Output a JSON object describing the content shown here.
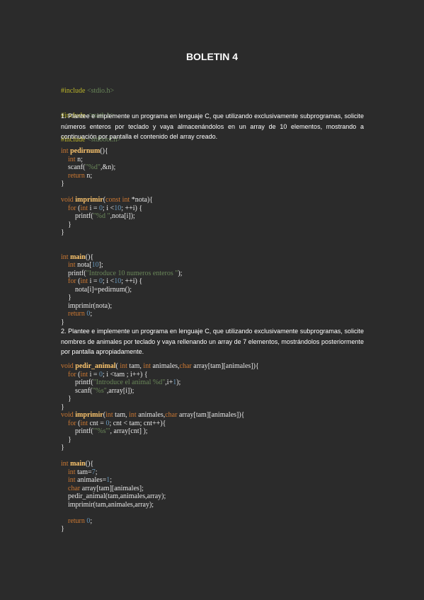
{
  "title": "BOLETIN 4",
  "includes": [
    {
      "directive": "#include",
      "header": "<stdio.h>"
    },
    {
      "directive": "#include",
      "header": "<math.h>"
    },
    {
      "directive": "#include",
      "header": "<stdbool.h>"
    }
  ],
  "exercise1": "1. Plantee e implemente un programa en lenguaje C, que utilizando exclusivamente subprogramas, solicite números enteros por teclado y vaya almacenándolos en un array de 10 elementos, mostrando a continuación por pantalla el contenido del array creado.",
  "exercise2": "2. Plantee e implemente un programa en lenguaje C, que utilizando exclusivamente subprogramas, solicite nombres de animales por teclado y vaya rellenando un array de 7 elementos, mostrándolos posteriormente por pantalla apropiadamente.",
  "code1": [
    [
      [
        "kw",
        "int "
      ],
      [
        "fn",
        "pedirnum"
      ],
      [
        "",
        "(){"
      ]
    ],
    [
      [
        "",
        "    "
      ],
      [
        "kw",
        "int "
      ],
      [
        "",
        "n;"
      ]
    ],
    [
      [
        "",
        "    scanf("
      ],
      [
        "str",
        "\"%d\""
      ],
      [
        "",
        ",&n);"
      ]
    ],
    [
      [
        "",
        "    "
      ],
      [
        "kw",
        "return "
      ],
      [
        "",
        "n;"
      ]
    ],
    [
      [
        "",
        "}"
      ]
    ],
    [
      [
        "",
        ""
      ]
    ],
    [
      [
        "kw",
        "void "
      ],
      [
        "fn",
        "imprimir"
      ],
      [
        "",
        "("
      ],
      [
        "kw",
        "const int "
      ],
      [
        "",
        "*nota){"
      ]
    ],
    [
      [
        "",
        "    "
      ],
      [
        "kw",
        "for "
      ],
      [
        "",
        "("
      ],
      [
        "kw",
        "int "
      ],
      [
        "",
        "i = "
      ],
      [
        "num",
        "0"
      ],
      [
        "",
        "; i <"
      ],
      [
        "num",
        "10"
      ],
      [
        "",
        "; ++i) {"
      ]
    ],
    [
      [
        "",
        "        printf("
      ],
      [
        "str",
        "\"%d \""
      ],
      [
        "",
        ",nota[i]);"
      ]
    ],
    [
      [
        "",
        "    }"
      ]
    ],
    [
      [
        "",
        "}"
      ]
    ],
    [
      [
        "",
        ""
      ]
    ],
    [
      [
        "",
        ""
      ]
    ],
    [
      [
        "kw",
        "int "
      ],
      [
        "fn",
        "main"
      ],
      [
        "",
        "(){"
      ]
    ],
    [
      [
        "",
        "    "
      ],
      [
        "kw",
        "int "
      ],
      [
        "",
        "nota["
      ],
      [
        "num",
        "10"
      ],
      [
        "",
        "];"
      ]
    ],
    [
      [
        "",
        "    printf("
      ],
      [
        "str",
        "\"Introduce 10 numeros enteros \""
      ],
      [
        "",
        ");"
      ]
    ],
    [
      [
        "",
        "    "
      ],
      [
        "kw",
        "for "
      ],
      [
        "",
        "("
      ],
      [
        "kw",
        "int "
      ],
      [
        "",
        "i = "
      ],
      [
        "num",
        "0"
      ],
      [
        "",
        "; i <"
      ],
      [
        "num",
        "10"
      ],
      [
        "",
        "; ++i) {"
      ]
    ],
    [
      [
        "",
        "        nota[i]=pedirnum();"
      ]
    ],
    [
      [
        "",
        "    }"
      ]
    ],
    [
      [
        "",
        "    imprimir(nota);"
      ]
    ],
    [
      [
        "",
        "    "
      ],
      [
        "kw",
        "return "
      ],
      [
        "num",
        "0"
      ],
      [
        "",
        ";"
      ]
    ],
    [
      [
        "",
        "}"
      ]
    ]
  ],
  "code2": [
    [
      [
        "kw",
        "void "
      ],
      [
        "fn",
        "pedir_animal"
      ],
      [
        "",
        "( "
      ],
      [
        "kw",
        "int "
      ],
      [
        "",
        "tam, "
      ],
      [
        "kw",
        "int "
      ],
      [
        "",
        "animales,"
      ],
      [
        "kw",
        "char "
      ],
      [
        "",
        "array[tam][animales]){"
      ]
    ],
    [
      [
        "",
        "    "
      ],
      [
        "kw",
        "for "
      ],
      [
        "",
        "("
      ],
      [
        "kw",
        "int "
      ],
      [
        "",
        "i = "
      ],
      [
        "num",
        "0"
      ],
      [
        "",
        "; i <tam ; i++) {"
      ]
    ],
    [
      [
        "",
        "        printf("
      ],
      [
        "str",
        "\"Introduce el animal %d\""
      ],
      [
        "",
        ",i+"
      ],
      [
        "num",
        "1"
      ],
      [
        "",
        ");"
      ]
    ],
    [
      [
        "",
        "        scanf("
      ],
      [
        "str",
        "\"%s\""
      ],
      [
        "",
        ",array[i]);"
      ]
    ],
    [
      [
        "",
        "    }"
      ]
    ],
    [
      [
        "",
        "}"
      ]
    ],
    [
      [
        "kw",
        "void "
      ],
      [
        "fn",
        "imprimir"
      ],
      [
        "",
        "("
      ],
      [
        "kw",
        "int "
      ],
      [
        "",
        "tam, "
      ],
      [
        "kw",
        "int "
      ],
      [
        "",
        "animales,"
      ],
      [
        "kw",
        "char "
      ],
      [
        "",
        "array[tam][animales]){"
      ]
    ],
    [
      [
        "",
        "    "
      ],
      [
        "kw",
        "for "
      ],
      [
        "",
        "("
      ],
      [
        "kw",
        "int "
      ],
      [
        "",
        "cnt = "
      ],
      [
        "num",
        "0"
      ],
      [
        "",
        "; cnt < tam; cnt++){"
      ]
    ],
    [
      [
        "",
        "        printf("
      ],
      [
        "str",
        "\"'%s'\""
      ],
      [
        "",
        ", array[cnt] );"
      ]
    ],
    [
      [
        "",
        "    }"
      ]
    ],
    [
      [
        "",
        "}"
      ]
    ],
    [
      [
        "",
        ""
      ]
    ],
    [
      [
        "kw",
        "int "
      ],
      [
        "fn",
        "main"
      ],
      [
        "",
        "(){"
      ]
    ],
    [
      [
        "",
        "    "
      ],
      [
        "kw",
        "int "
      ],
      [
        "",
        "tam="
      ],
      [
        "num",
        "7"
      ],
      [
        "",
        ";"
      ]
    ],
    [
      [
        "",
        "    "
      ],
      [
        "kw",
        "int "
      ],
      [
        "",
        "animales="
      ],
      [
        "num",
        "1"
      ],
      [
        "",
        ";"
      ]
    ],
    [
      [
        "",
        "    "
      ],
      [
        "kw",
        "char "
      ],
      [
        "",
        "array[tam][animales];"
      ]
    ],
    [
      [
        "",
        "    pedir_animal(tam,animales,array);"
      ]
    ],
    [
      [
        "",
        "    imprimir(tam,animales,array);"
      ]
    ],
    [
      [
        "",
        ""
      ]
    ],
    [
      [
        "",
        "    "
      ],
      [
        "kw",
        "return "
      ],
      [
        "num",
        "0"
      ],
      [
        "",
        ";"
      ]
    ],
    [
      [
        "",
        "}"
      ]
    ]
  ]
}
